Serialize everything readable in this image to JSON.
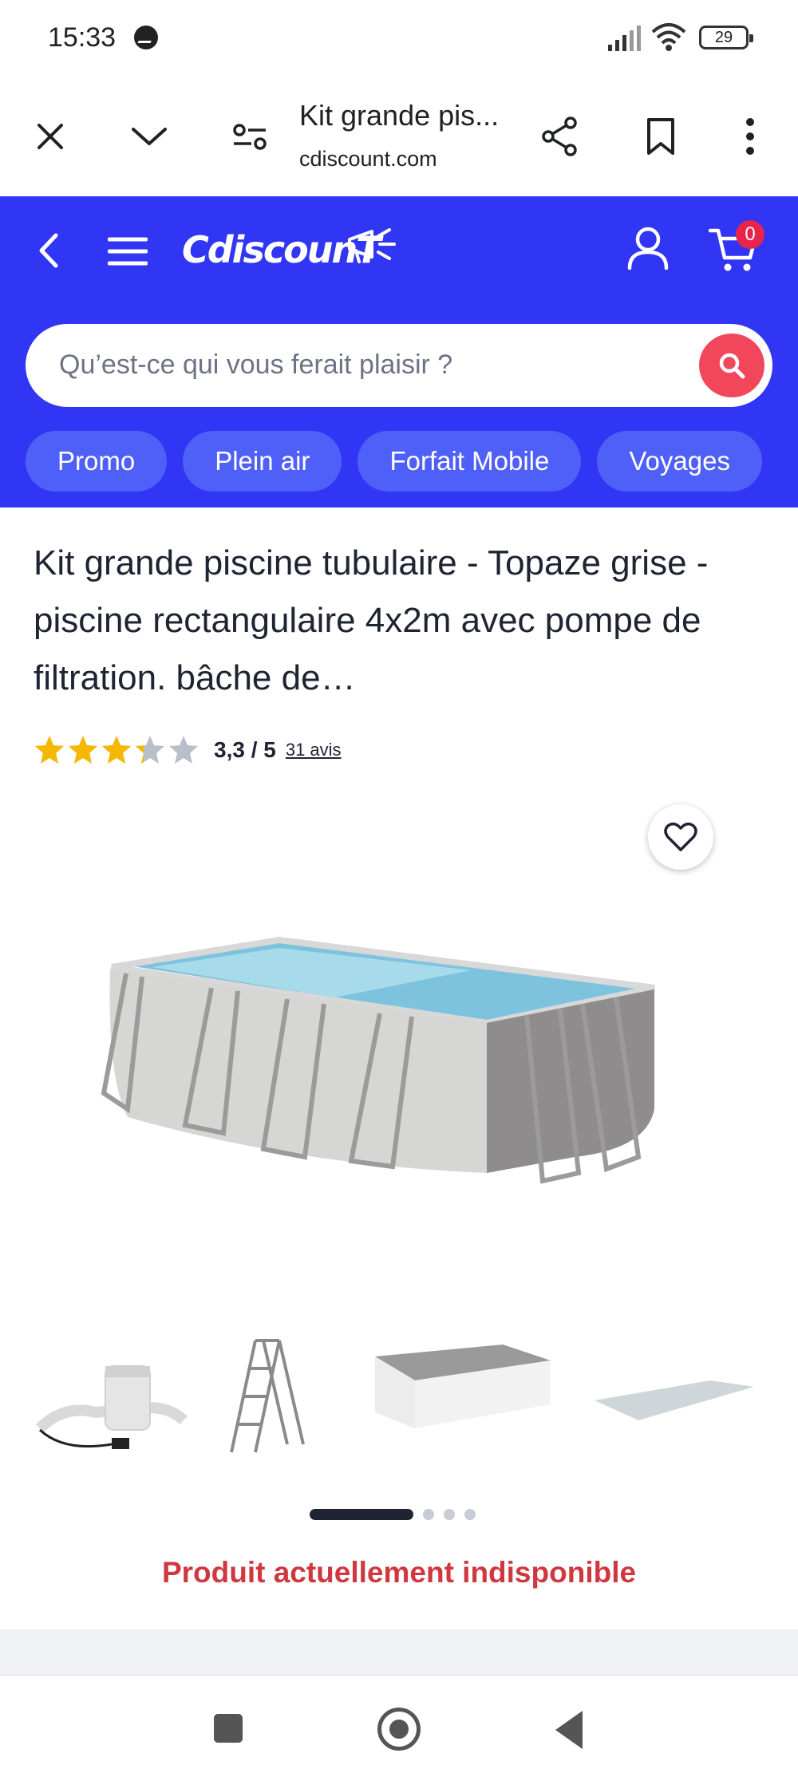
{
  "status_bar": {
    "time": "15:33",
    "battery": "29"
  },
  "tab_bar": {
    "title": "Kit grande pis...",
    "url": "cdiscount.com"
  },
  "header": {
    "logo": "CdiscounT",
    "cart_count": "0",
    "brand_color": "#3136f4",
    "search": {
      "placeholder": "Qu’est-ce qui vous ferait plaisir ?"
    },
    "chips": [
      "Promo",
      "Plein air",
      "Forfait Mobile",
      "Voyages"
    ]
  },
  "product": {
    "title": "Kit grande piscine tubulaire - Topaze grise - piscine rectangulaire 4x2m avec pompe de filtration. bâche de…",
    "rating_value": 3.3,
    "rating_max": 5,
    "rating_text": "3,3 / 5",
    "reviews": "31 avis",
    "availability": "Produit actuellement indisponible",
    "carousel": {
      "total": 4,
      "current": 1
    },
    "thumbnails": [
      "filter-pump-icon",
      "ladder-icon",
      "pool-cover-icon",
      "ground-sheet-icon"
    ]
  }
}
